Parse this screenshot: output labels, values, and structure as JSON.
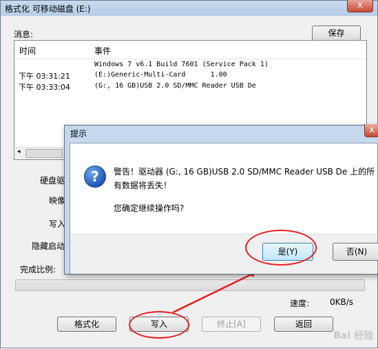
{
  "window": {
    "title": "格式化 可移动磁盘 (E:)",
    "close": "x"
  },
  "messages": {
    "label": "消息:",
    "save_button": "保存",
    "columns": [
      "时间",
      "事件"
    ],
    "rows": [
      {
        "time": "",
        "event": "Windows 7 v6.1 Build 7601 (Service Pack 1)"
      },
      {
        "time": "下午 03:31:21",
        "event": "(E:)Generic-Multi-Card      1.00"
      },
      {
        "time": "下午 03:33:04",
        "event": "(G:, 16 GB)USB 2.0 SD/MMC Reader USB De"
      }
    ]
  },
  "fields": {
    "disk": "硬盘驱",
    "image": "映像",
    "write_mode": "写入",
    "hide_boot": "隐藏启动"
  },
  "progress": {
    "label": "完成比例:",
    "value": 0,
    "speed_label": "速度:",
    "speed_value": "0KB/s"
  },
  "buttons": {
    "format": "格式化",
    "write": "写入",
    "abort": "终止[A]",
    "back": "返回"
  },
  "dialog": {
    "title": "提示",
    "icon": "question-icon",
    "message_line1": "警告！驱动器 (G:, 16 GB)USB 2.0 SD/MMC Reader USB De 上的所",
    "message_line2": "有数据将丢失！",
    "question": "您确定继续操作吗?",
    "yes": "是(Y)",
    "no": "否(N)",
    "close": "x"
  },
  "watermark": "Bai 经验"
}
